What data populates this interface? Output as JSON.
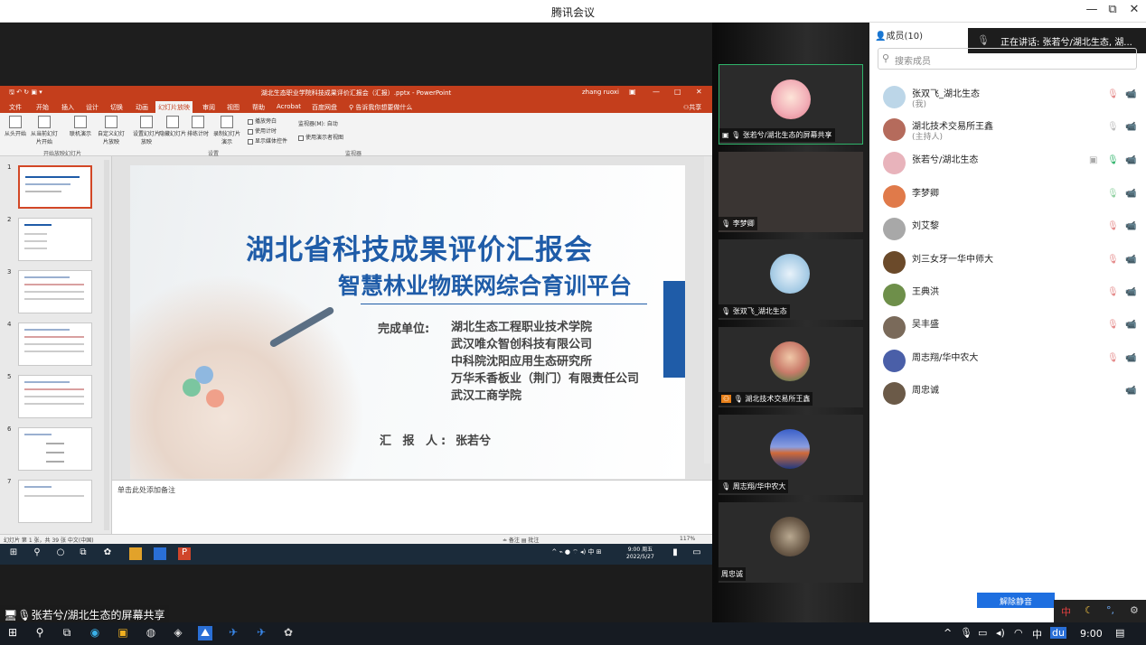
{
  "window": {
    "title": "腾讯会议",
    "min": "—",
    "max": "⧉",
    "close": "✕"
  },
  "ppt": {
    "filename": "湖北生态职业学院科技成果评价汇报会（汇报）.pptx - PowerPoint",
    "user": "zhang ruoxi",
    "tabs": [
      "文件",
      "开始",
      "插入",
      "设计",
      "切换",
      "动画",
      "幻灯片放映",
      "审阅",
      "视图",
      "帮助",
      "Acrobat",
      "百度网盘",
      "告诉我你想要做什么"
    ],
    "share": "共享",
    "ribbon_buttons": [
      "从头开始",
      "从当前幻灯片开始",
      "联机演示",
      "自定义幻灯片放映",
      "设置幻灯片放映",
      "隐藏幻灯片",
      "排练计时",
      "录制幻灯片演示"
    ],
    "ribbon_checks": [
      "播放旁白",
      "使用计时",
      "显示媒体控件",
      "使用演示者视图"
    ],
    "monitor_label": "监视器(M): 自动",
    "groups": [
      "开始放映幻灯片",
      "设置",
      "监视器"
    ],
    "thumb_numbers": [
      "1",
      "2",
      "3",
      "4",
      "5",
      "6",
      "7"
    ],
    "notes": "单击此处添加备注",
    "status_left": "幻灯片 第 1 张，共 39 张   中文(中国)",
    "status_right": "≐ 备注   ▤ 批注",
    "zoom": "117%",
    "clock_time": "9:00 周五",
    "clock_date": "2022/5/27"
  },
  "slide": {
    "title": "湖北省科技成果评价汇报会",
    "subtitle": "智慧林业物联网综合育训平台",
    "unit_label": "完成单位:",
    "orgs": [
      "湖北生态工程职业技术学院",
      "武汉唯众智创科技有限公司",
      "中科院沈阳应用生态研究所",
      "万华禾香板业（荆门）有限责任公司",
      "武汉工商学院"
    ],
    "reporter_label": "汇 报 人:",
    "reporter": "张若兮"
  },
  "share_label": "张若兮/湖北生态的屏幕共享",
  "videos": [
    {
      "name": "张若兮/湖北生态的屏幕共享",
      "color": "#f2c3c8"
    },
    {
      "name": "李梦卿",
      "color": ""
    },
    {
      "name": "张双飞_湖北生态",
      "color": "#a9cde6"
    },
    {
      "name": "湖北技术交易所王鑫",
      "color": "#c97b6a"
    },
    {
      "name": "周志翔/华中农大",
      "color": "#4a5fa8"
    },
    {
      "name": "周忠诚",
      "color": "#8a7a66"
    }
  ],
  "members": {
    "header": "成员(10)",
    "speaking": "正在讲话: 张若兮/湖北生态, 湖...",
    "search_placeholder": "搜索成员",
    "list": [
      {
        "name": "张双飞_湖北生态",
        "sub": "(我)",
        "color": "#bcd6e8"
      },
      {
        "name": "湖北技术交易所王鑫",
        "sub": "(主持人)",
        "color": "#b56b5c"
      },
      {
        "name": "张若兮/湖北生态",
        "sub": "",
        "color": "#e8b3bb"
      },
      {
        "name": "李梦卿",
        "sub": "",
        "color": "#e07a4a"
      },
      {
        "name": "刘艾黎",
        "sub": "",
        "color": "#a8a8a8"
      },
      {
        "name": "刘三女牙一华中师大",
        "sub": "",
        "color": "#6b4a2a"
      },
      {
        "name": "王典洪",
        "sub": "",
        "color": "#6e8f4a"
      },
      {
        "name": "吴丰盛",
        "sub": "",
        "color": "#7a6a5a"
      },
      {
        "name": "周志翔/华中农大",
        "sub": "",
        "color": "#4a5fa8"
      },
      {
        "name": "周忠诚",
        "sub": "",
        "color": "#6b5a48"
      }
    ],
    "unmute": "解除静音"
  },
  "ime": {
    "lang": "中",
    "moon": "☾",
    "punct": "°,",
    "gear": "⚙"
  },
  "taskbar": {
    "time": "9:00",
    "ime": "中"
  }
}
